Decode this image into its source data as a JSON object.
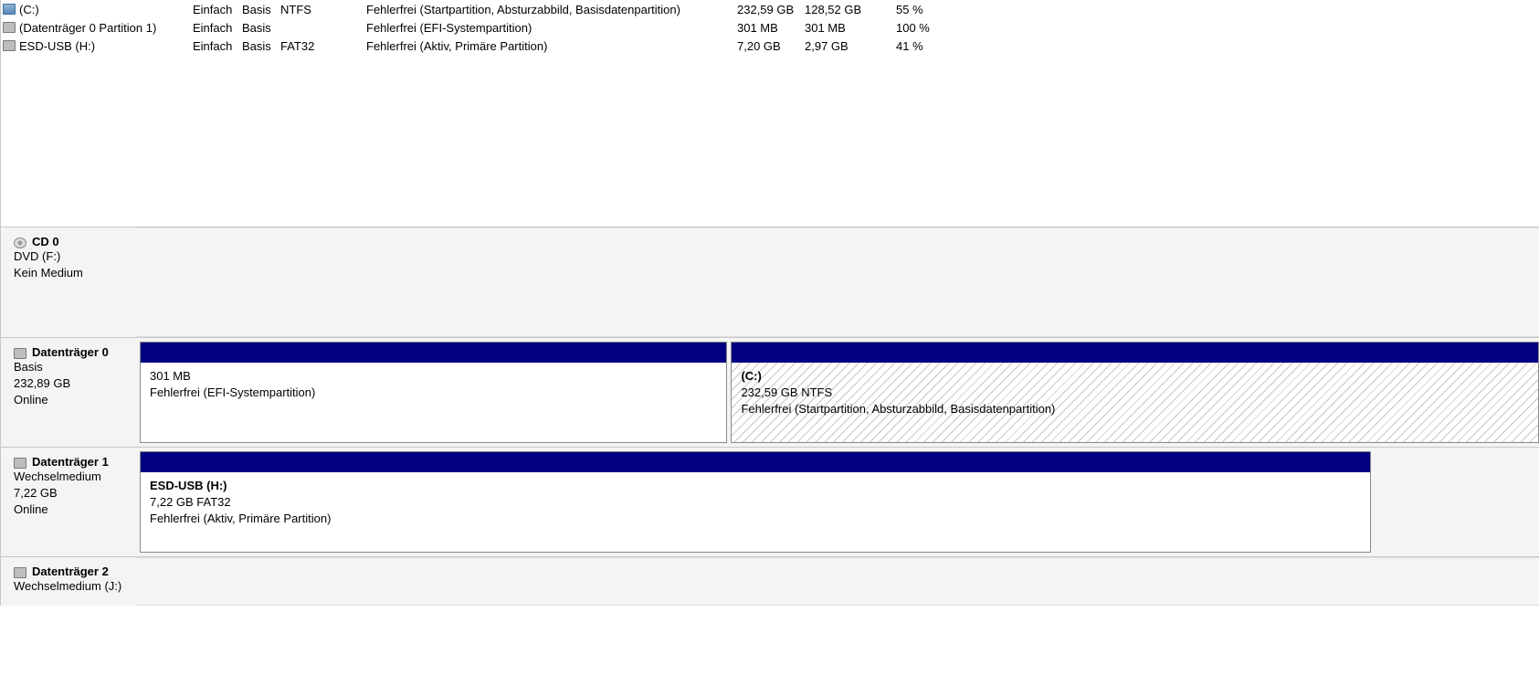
{
  "volumes": [
    {
      "icon": "drive",
      "name": "(C:)",
      "layout": "Einfach",
      "type": "Basis",
      "fs": "NTFS",
      "status": "Fehlerfrei (Startpartition, Absturzabbild, Basisdatenpartition)",
      "capacity": "232,59 GB",
      "free": "128,52 GB",
      "free_pct": "55 %"
    },
    {
      "icon": "part",
      "name": "(Datenträger 0 Partition 1)",
      "layout": "Einfach",
      "type": "Basis",
      "fs": "",
      "status": "Fehlerfrei (EFI-Systempartition)",
      "capacity": "301 MB",
      "free": "301 MB",
      "free_pct": "100 %"
    },
    {
      "icon": "part",
      "name": "ESD-USB (H:)",
      "layout": "Einfach",
      "type": "Basis",
      "fs": "FAT32",
      "status": "Fehlerfrei (Aktiv, Primäre Partition)",
      "capacity": "7,20 GB",
      "free": "2,97 GB",
      "free_pct": "41 %"
    }
  ],
  "disks": [
    {
      "id": "cd0",
      "icon": "cd",
      "title": "CD 0",
      "line1": "DVD (F:)",
      "line2": "",
      "line3": "Kein Medium",
      "partitions": []
    },
    {
      "id": "disk0",
      "icon": "hdd",
      "title": "Datenträger 0",
      "line1": "Basis",
      "line2": "232,89 GB",
      "line3": "Online",
      "partitions": [
        {
          "width_pct": 42,
          "hatched": false,
          "name": "",
          "size_fs": "301 MB",
          "status": "Fehlerfrei (EFI-Systempartition)"
        },
        {
          "width_pct": 58,
          "hatched": true,
          "name": "(C:)",
          "size_fs": "232,59 GB NTFS",
          "status": "Fehlerfrei (Startpartition, Absturzabbild, Basisdatenpartition)"
        }
      ]
    },
    {
      "id": "disk1",
      "icon": "hdd",
      "title": "Datenträger 1",
      "line1": "Wechselmedium",
      "line2": "7,22 GB",
      "line3": "Online",
      "partitions": [
        {
          "width_pct": 88,
          "hatched": false,
          "name": "ESD-USB  (H:)",
          "size_fs": "7,22 GB FAT32",
          "status": "Fehlerfrei (Aktiv, Primäre Partition)"
        }
      ]
    },
    {
      "id": "disk2",
      "icon": "hdd",
      "title": "Datenträger 2",
      "line1": "Wechselmedium (J:)",
      "line2": "",
      "line3": "",
      "partitions": [],
      "cut": true
    }
  ]
}
